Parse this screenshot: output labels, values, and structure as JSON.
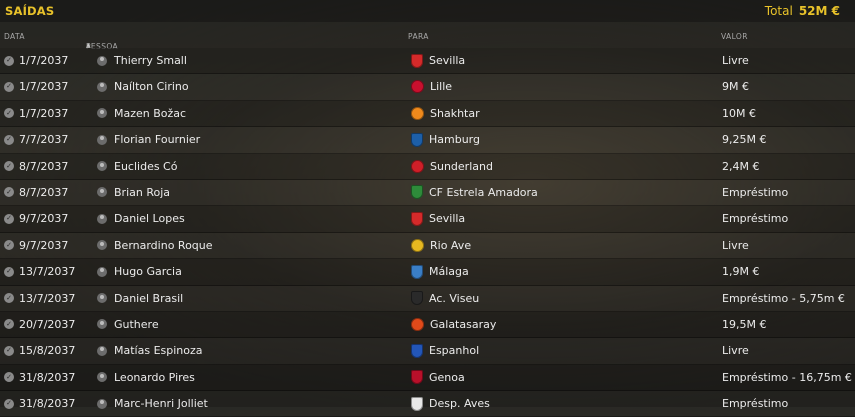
{
  "header": {
    "title": "SAÍDAS",
    "total_label": "Total",
    "total_value": "52M €"
  },
  "columns": {
    "date": "DATA",
    "person": "PESSOA",
    "club": "PARA",
    "value": "VALOR"
  },
  "rows": [
    {
      "date": "1/7/2037",
      "person": "Thierry Small",
      "club": "Sevilla",
      "value": "Livre",
      "crest_color": "#d42a2a",
      "crest_shape": "shield"
    },
    {
      "date": "1/7/2037",
      "person": "Naílton Cirino",
      "club": "Lille",
      "value": "9M €",
      "crest_color": "#c8102e",
      "crest_shape": "round"
    },
    {
      "date": "1/7/2037",
      "person": "Mazen Božac",
      "club": "Shakhtar",
      "value": "10M €",
      "crest_color": "#f08a1c",
      "crest_shape": "round"
    },
    {
      "date": "7/7/2037",
      "person": "Florian Fournier",
      "club": "Hamburg",
      "value": "9,25M €",
      "crest_color": "#1d5fa8",
      "crest_shape": "shield"
    },
    {
      "date": "8/7/2037",
      "person": "Euclides Có",
      "club": "Sunderland",
      "value": "2,4M €",
      "crest_color": "#d01f28",
      "crest_shape": "round"
    },
    {
      "date": "8/7/2037",
      "person": "Brian Roja",
      "club": "CF Estrela Amadora",
      "value": "Empréstimo",
      "crest_color": "#2e8b3a",
      "crest_shape": "shield"
    },
    {
      "date": "9/7/2037",
      "person": "Daniel Lopes",
      "club": "Sevilla",
      "value": "Empréstimo",
      "crest_color": "#d42a2a",
      "crest_shape": "shield"
    },
    {
      "date": "9/7/2037",
      "person": "Bernardino Roque",
      "club": "Rio Ave",
      "value": "Livre",
      "crest_color": "#e6b820",
      "crest_shape": "round"
    },
    {
      "date": "13/7/2037",
      "person": "Hugo Garcia",
      "club": "Málaga",
      "value": "1,9M €",
      "crest_color": "#3a7ec6",
      "crest_shape": "shield"
    },
    {
      "date": "13/7/2037",
      "person": "Daniel Brasil",
      "club": "Ac. Viseu",
      "value": "Empréstimo - 5,75m €",
      "crest_color": "#2a2a2a",
      "crest_shape": "shield"
    },
    {
      "date": "20/7/2037",
      "person": "Guthere",
      "club": "Galatasaray",
      "value": "19,5M €",
      "crest_color": "#e04a1a",
      "crest_shape": "round"
    },
    {
      "date": "15/8/2037",
      "person": "Matías Espinoza",
      "club": "Espanhol",
      "value": "Livre",
      "crest_color": "#2356b8",
      "crest_shape": "shield"
    },
    {
      "date": "31/8/2037",
      "person": "Leonardo Pires",
      "club": "Genoa",
      "value": "Empréstimo - 16,75m €",
      "crest_color": "#b8102a",
      "crest_shape": "shield"
    },
    {
      "date": "31/8/2037",
      "person": "Marc-Henri Jolliet",
      "club": "Desp. Aves",
      "value": "Empréstimo",
      "crest_color": "#e8e8e8",
      "crest_shape": "shield"
    }
  ]
}
